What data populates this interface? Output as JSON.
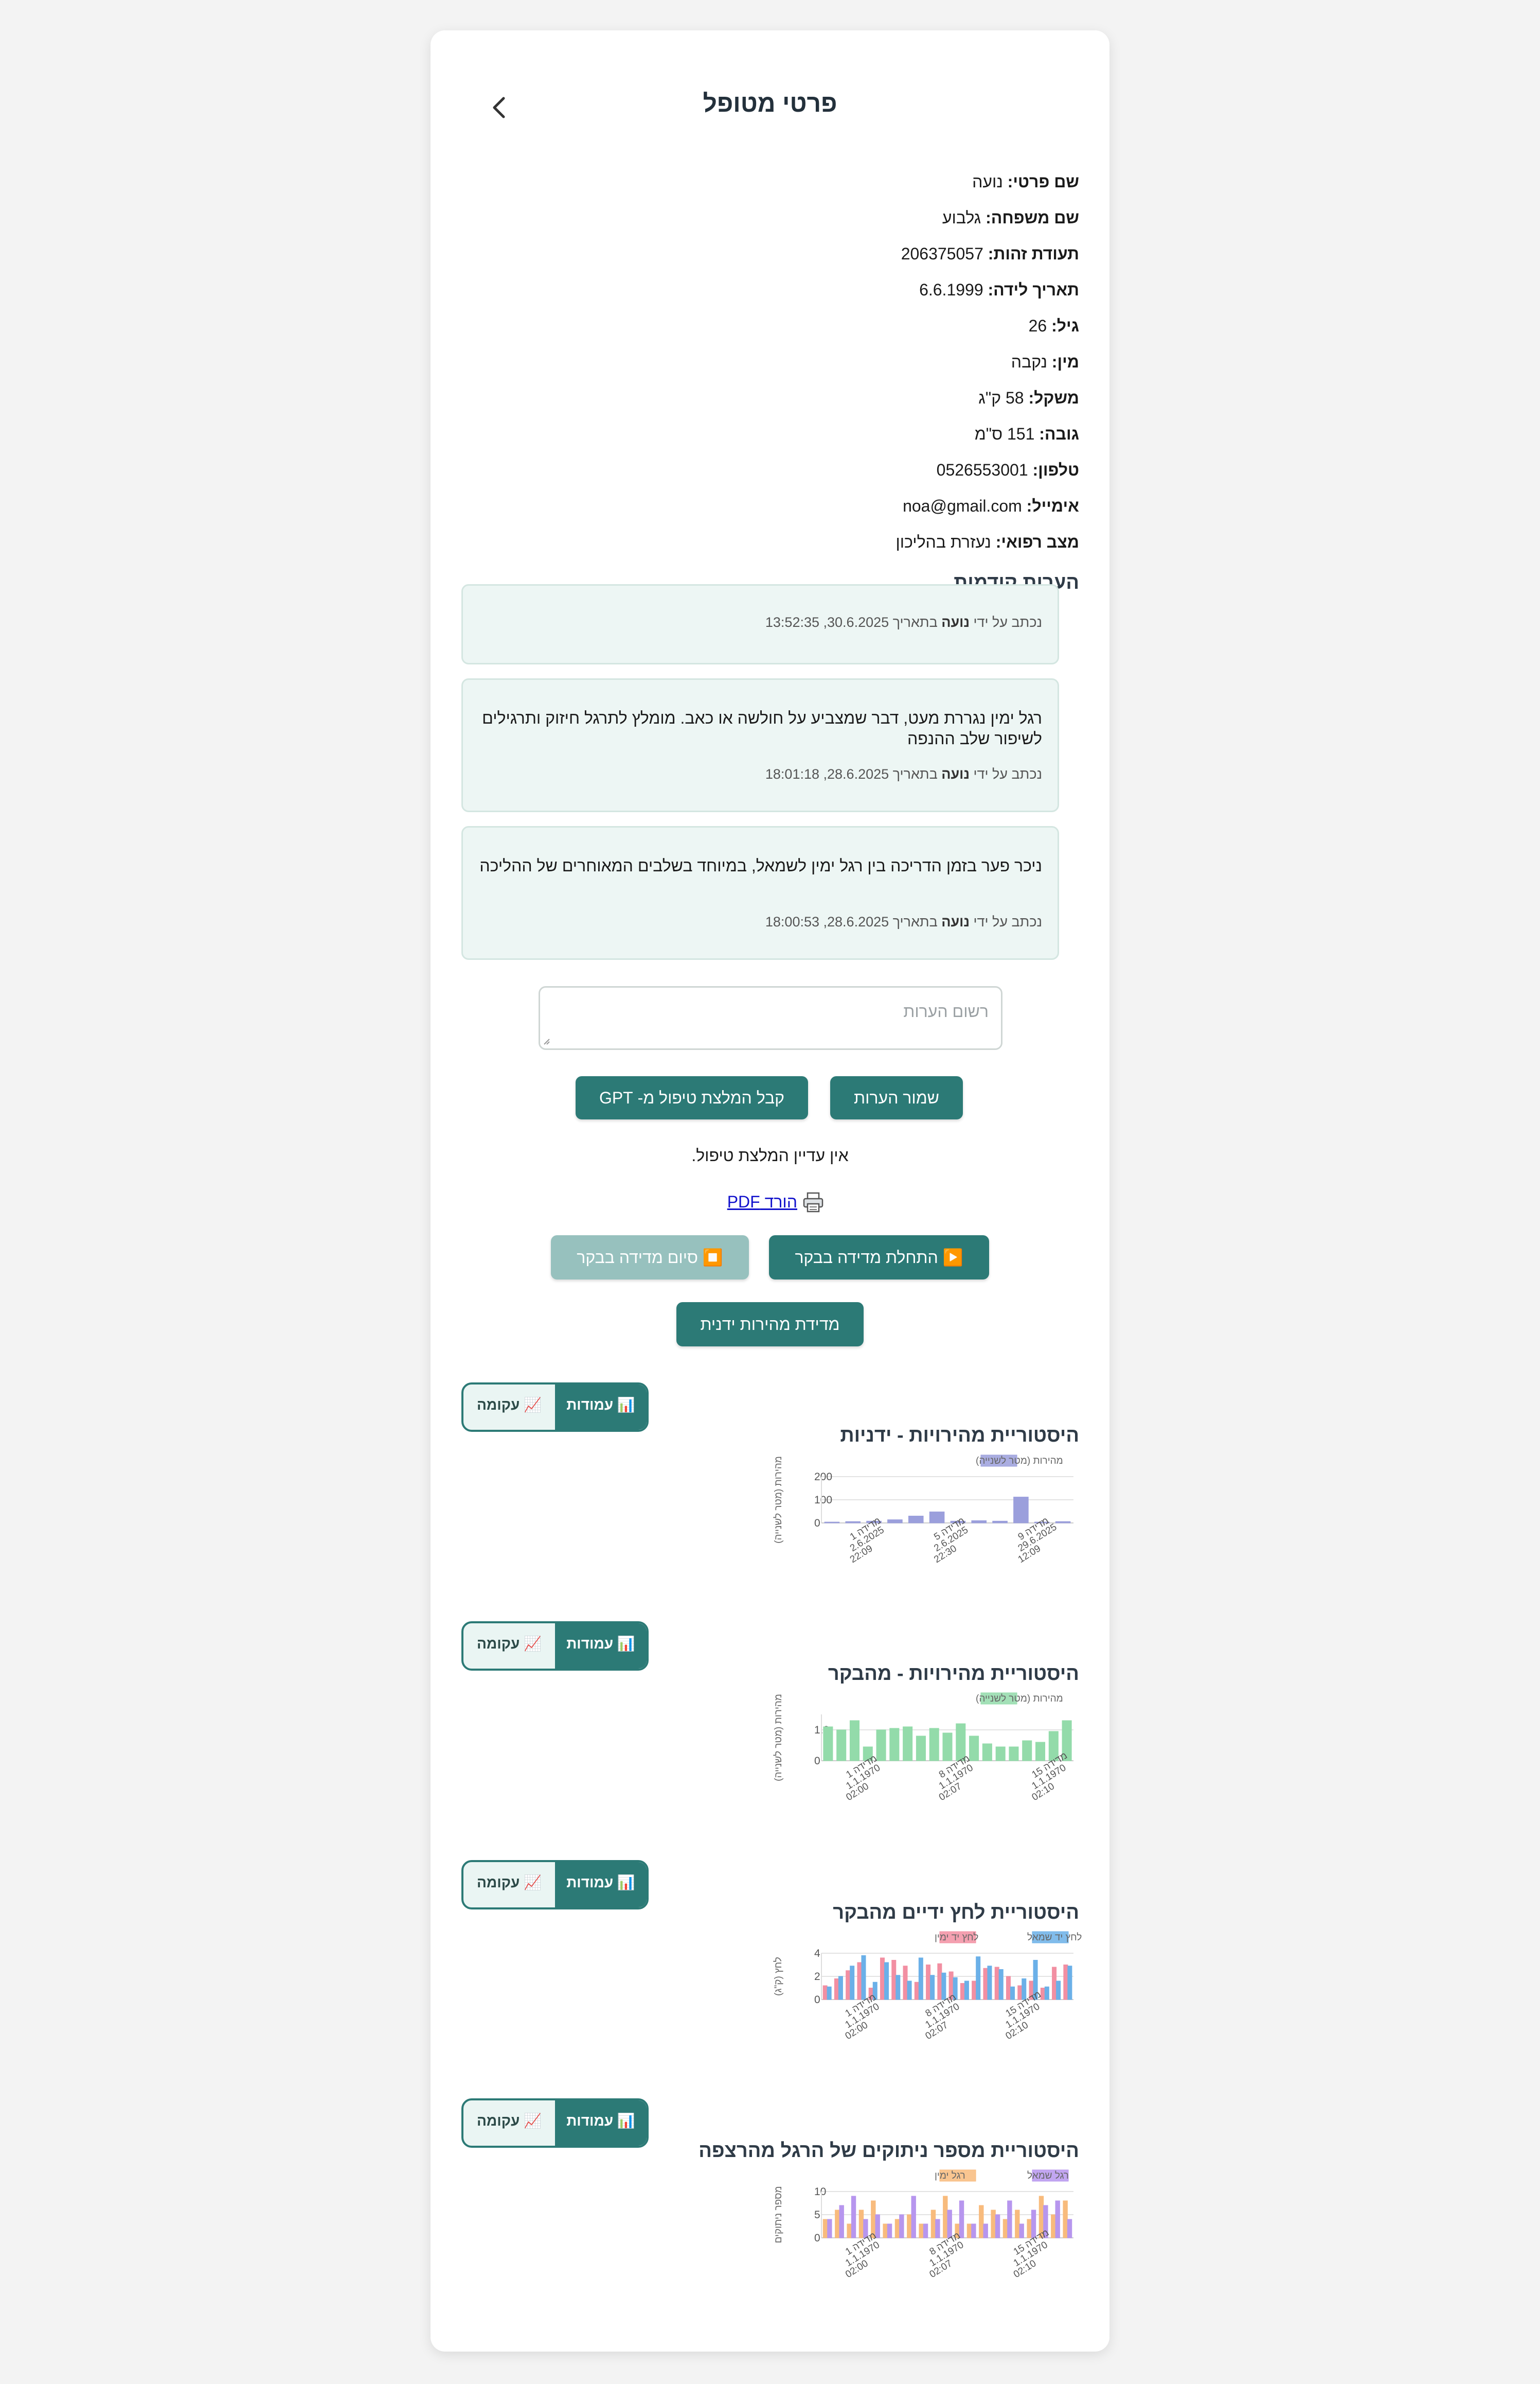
{
  "header": {
    "title": "פרטי מטופל"
  },
  "patient": {
    "fields": [
      {
        "label": "שם פרטי:",
        "value": "נועה"
      },
      {
        "label": "שם משפחה:",
        "value": "גלבוע"
      },
      {
        "label": "תעודת זהות:",
        "value": "206375057"
      },
      {
        "label": "תאריך לידה:",
        "value": "6.6.1999"
      },
      {
        "label": "גיל:",
        "value": "26"
      },
      {
        "label": "מין:",
        "value": "נקבה"
      },
      {
        "label": "משקל:",
        "value": "58 ק\"ג"
      },
      {
        "label": "גובה:",
        "value": "151 ס\"מ"
      },
      {
        "label": "טלפון:",
        "value": "0526553001"
      },
      {
        "label": "אימייל:",
        "value": "noa@gmail.com"
      },
      {
        "label": "מצב רפואי:",
        "value": "נעזרת בהליכון"
      }
    ]
  },
  "notes": {
    "heading": "הערות קודמות",
    "items": [
      {
        "text": "",
        "meta_prefix": "נכתב על ידי",
        "author": "נועה",
        "meta_suffix": "בתאריך 30.6.2025, 13:52:35"
      },
      {
        "text": "רגל ימין נגררת מעט, דבר שמצביע על חולשה או כאב. מומלץ לתרגל חיזוק ותרגילים לשיפור שלב ההנפה",
        "meta_prefix": "נכתב על ידי",
        "author": "נועה",
        "meta_suffix": "בתאריך 28.6.2025, 18:01:18"
      },
      {
        "text": "ניכר פער בזמן הדריכה בין רגל ימין לשמאל, במיוחד בשלבים המאוחרים של ההליכה",
        "meta_prefix": "נכתב על ידי",
        "author": "נועה",
        "meta_suffix": "בתאריך 28.6.2025, 18:00:53"
      }
    ],
    "input_placeholder": "רשום הערות"
  },
  "actions": {
    "save_notes": "שמור הערות",
    "gpt": "קבל המלצת טיפול מ- GPT",
    "no_recommendation": "אין עדיין המלצת טיפול.",
    "pdf_icon": "printer-icon",
    "pdf_link": "הורד PDF",
    "start_measure": "▶️ התחלת מדידה בבקר",
    "stop_measure": "⏹️ סיום מדידה בבקר",
    "manual_speed": "מדידת מהירות ידנית"
  },
  "toggle": {
    "bar": "עמודות",
    "line": "עקומה",
    "bar_icon": "bar-chart-icon",
    "line_icon": "line-chart-icon"
  },
  "chart_headings": [
    "היסטוריית מהירויות - ידניות",
    "היסטוריית מהירויות - מהבקר",
    "היסטוריית לחץ ידיים מהבקר",
    "היסטוריית מספר ניתוקים של הרגל מהרצפה"
  ],
  "chart_data": [
    {
      "type": "bar",
      "title": "היסטוריית מהירויות - ידניות",
      "ylabel": "מהירות (מטר לשנייה)",
      "ylim": [
        0,
        200
      ],
      "yticks": [
        "0",
        "100",
        "200"
      ],
      "series": [
        {
          "name": "מהירות (מטר לשנייה)",
          "color": "#9b9fdc",
          "values": [
            4,
            6,
            8,
            14,
            30,
            48,
            8,
            10,
            8,
            112,
            4,
            6
          ]
        }
      ],
      "tick_labels": [
        [
          "מדידה 1",
          "2.6.2025",
          "22:09"
        ],
        [
          "מדידה 5",
          "2.6.2025",
          "22:30"
        ],
        [
          "מדידה 9",
          "29.6.2025",
          "12:09"
        ]
      ]
    },
    {
      "type": "bar",
      "title": "היסטוריית מהירויות - מהבקר",
      "ylabel": "מהירות (מטר לשנייה)",
      "ylim": [
        0,
        1.5
      ],
      "yticks": [
        "0",
        "1.0"
      ],
      "series": [
        {
          "name": "מהירות (מטר לשנייה)",
          "color": "#93dbaa",
          "values": [
            1.1,
            1.0,
            1.3,
            0.45,
            1.0,
            1.05,
            1.1,
            0.8,
            1.05,
            0.9,
            1.2,
            0.8,
            0.55,
            0.45,
            0.45,
            0.65,
            0.6,
            0.95,
            1.3
          ]
        }
      ],
      "tick_labels": [
        [
          "מדידה 1",
          "1.1.1970",
          "02:00"
        ],
        [
          "מדידה 8",
          "1.1.1970",
          "02:07"
        ],
        [
          "מדידה 15",
          "1.1.1970",
          "02:10"
        ]
      ]
    },
    {
      "type": "bar",
      "title": "היסטוריית לחץ ידיים מהבקר",
      "ylabel": "לחץ (ק\"ג)",
      "ylim": [
        0,
        4
      ],
      "yticks": [
        "0",
        "2",
        "4"
      ],
      "series": [
        {
          "name": "לחץ יד ימין",
          "color": "#f28fa2",
          "values": [
            1.2,
            1.8,
            2.5,
            3.2,
            1.0,
            3.6,
            3.4,
            2.9,
            1.5,
            3.0,
            3.1,
            2.4,
            1.4,
            1.6,
            2.7,
            2.8,
            2.0,
            1.2,
            1.6,
            1.0,
            2.8,
            3.0
          ]
        },
        {
          "name": "לחץ יד שמאל",
          "color": "#6bb0e8",
          "values": [
            1.1,
            2.0,
            2.9,
            3.8,
            1.5,
            3.2,
            2.1,
            1.6,
            3.6,
            2.1,
            2.3,
            1.9,
            1.6,
            3.7,
            2.9,
            2.6,
            1.1,
            1.8,
            3.4,
            1.1,
            1.6,
            2.9
          ]
        }
      ],
      "tick_labels": [
        [
          "מדידה 1",
          "1.1.1970",
          "02:00"
        ],
        [
          "מדידה 8",
          "1.1.1970",
          "02:07"
        ],
        [
          "מדידה 15",
          "1.1.1970",
          "02:10"
        ]
      ]
    },
    {
      "type": "bar",
      "title": "היסטוריית מספר ניתוקים של הרגל מהרצפה",
      "ylabel": "מספר ניתוקים",
      "ylim": [
        0,
        10
      ],
      "yticks": [
        "0",
        "5",
        "10"
      ],
      "series": [
        {
          "name": "רגל ימין",
          "color": "#f8bb7d",
          "values": [
            4,
            6,
            3,
            6,
            8,
            3,
            4,
            5,
            3,
            6,
            9,
            3,
            3,
            7,
            6,
            4,
            6,
            4,
            9,
            5,
            8
          ]
        },
        {
          "name": "רגל שמאל",
          "color": "#b796ee",
          "values": [
            4,
            7,
            9,
            4,
            5,
            3,
            5,
            9,
            3,
            4,
            6,
            8,
            3,
            3,
            5,
            8,
            3,
            6,
            7,
            8,
            4
          ]
        }
      ],
      "tick_labels": [
        [
          "מדידה 1",
          "1.1.1970",
          "02:00"
        ],
        [
          "מדידה 8",
          "1.1.1970",
          "02:07"
        ],
        [
          "מדידה 15",
          "1.1.1970",
          "02:10"
        ]
      ]
    }
  ]
}
